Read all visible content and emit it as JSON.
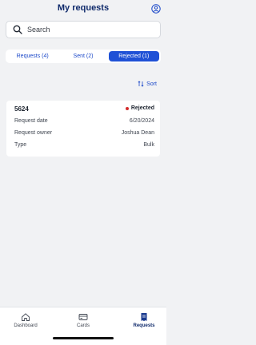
{
  "header": {
    "title": "My requests",
    "profile_icon": "user-circle-icon"
  },
  "search": {
    "placeholder": "Search",
    "icon": "search-icon"
  },
  "tabs": [
    {
      "label": "Requests (4)",
      "active": false
    },
    {
      "label": "Sent (2)",
      "active": false
    },
    {
      "label": "Rejected (1)",
      "active": true
    }
  ],
  "sort": {
    "label": "Sort",
    "icon": "sort-arrows-icon"
  },
  "card": {
    "id": "5624",
    "status": "Rejected",
    "status_color": "#d32b2b",
    "rows": [
      {
        "label": "Request date",
        "value": "6/20/2024"
      },
      {
        "label": "Request owner",
        "value": "Joshua Dean"
      },
      {
        "label": "Type",
        "value": "Bulk"
      }
    ]
  },
  "nav": [
    {
      "label": "Dashboard",
      "icon": "home-icon",
      "active": false
    },
    {
      "label": "Cards",
      "icon": "card-icon",
      "active": false
    },
    {
      "label": "Requests",
      "icon": "requests-doc-icon",
      "active": true
    }
  ],
  "colors": {
    "accent": "#1f51d6",
    "title": "#0f2a6b",
    "background": "#f1f2f4"
  }
}
